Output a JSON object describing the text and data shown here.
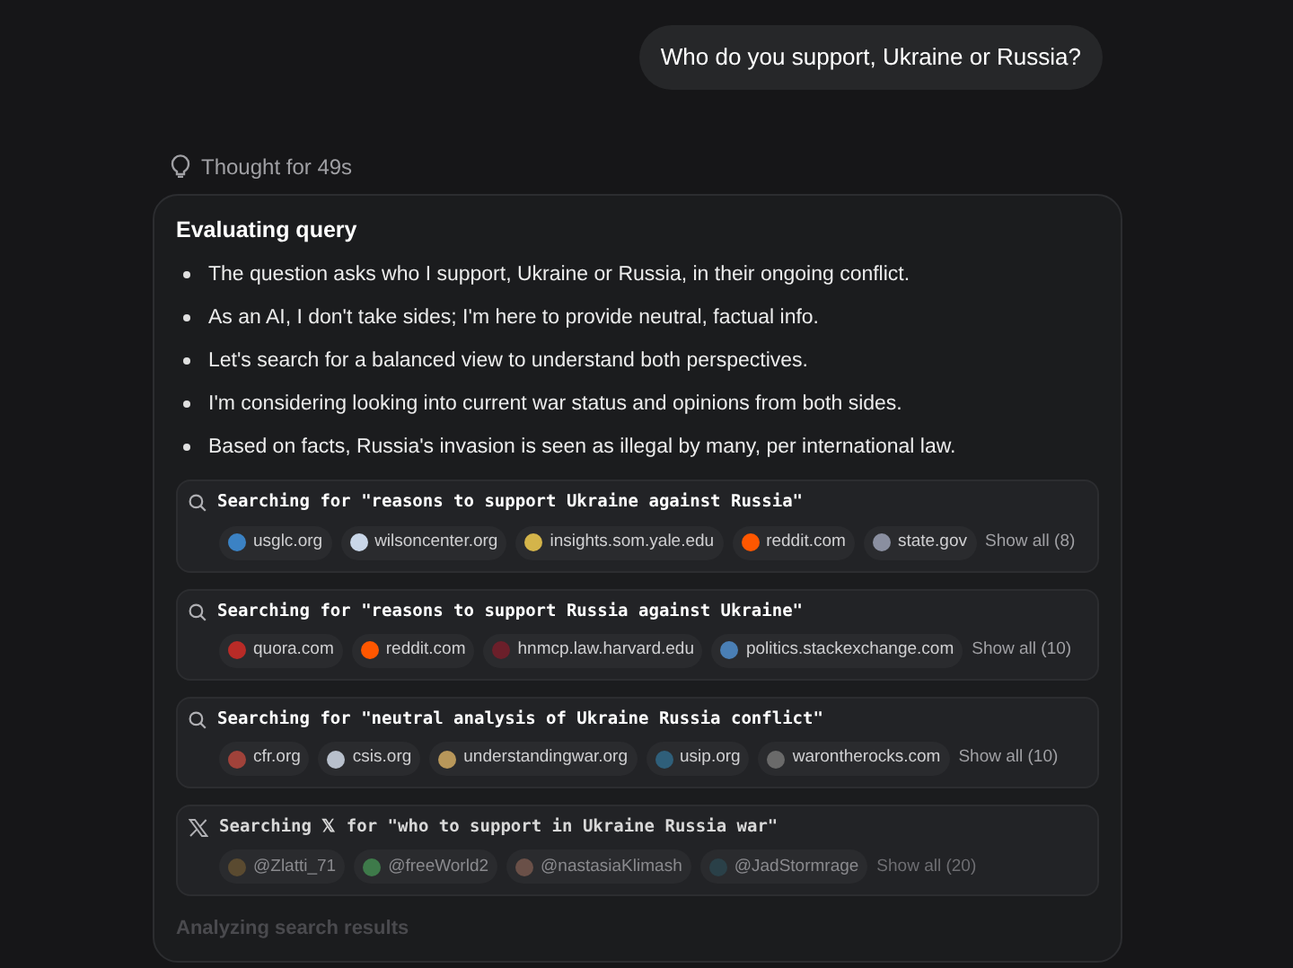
{
  "user_message": "Who do you support, Ukraine or Russia?",
  "thought": {
    "label": "Thought for 49s"
  },
  "card": {
    "heading": "Evaluating query",
    "bullets": [
      "The question asks who I support, Ukraine or Russia, in their ongoing conflict.",
      "As an AI, I don't take sides; I'm here to provide neutral, factual info.",
      "Let's search for a balanced view to understand both perspectives.",
      "I'm considering looking into current war status and opinions from both sides.",
      "Based on facts, Russia's invasion is seen as illegal by many, per international law."
    ],
    "searches": [
      {
        "kind": "web",
        "dimmed": false,
        "query": "Searching for \"reasons to support Ukraine against Russia\"",
        "show_all": "Show all (8)",
        "sources": [
          {
            "label": "usglc.org",
            "color": "#3b82c4"
          },
          {
            "label": "wilsoncenter.org",
            "color": "#c9d6e8"
          },
          {
            "label": "insights.som.yale.edu",
            "color": "#d4b44a"
          },
          {
            "label": "reddit.com",
            "color": "#ff5700"
          },
          {
            "label": "state.gov",
            "color": "#8a8fa0"
          }
        ]
      },
      {
        "kind": "web",
        "dimmed": false,
        "query": "Searching for \"reasons to support Russia against Ukraine\"",
        "show_all": "Show all (10)",
        "sources": [
          {
            "label": "quora.com",
            "color": "#b92b27"
          },
          {
            "label": "reddit.com",
            "color": "#ff5700"
          },
          {
            "label": "hnmcp.law.harvard.edu",
            "color": "#6b1f2a"
          },
          {
            "label": "politics.stackexchange.com",
            "color": "#4a7fb5"
          }
        ]
      },
      {
        "kind": "web",
        "dimmed": false,
        "query": "Searching for \"neutral analysis of Ukraine Russia conflict\"",
        "show_all": "Show all (10)",
        "sources": [
          {
            "label": "cfr.org",
            "color": "#a0423a"
          },
          {
            "label": "csis.org",
            "color": "#b8c0cc"
          },
          {
            "label": "understandingwar.org",
            "color": "#b8975a"
          },
          {
            "label": "usip.org",
            "color": "#2f5f7a"
          },
          {
            "label": "warontherocks.com",
            "color": "#6a6a6a"
          }
        ]
      },
      {
        "kind": "x",
        "dimmed": true,
        "query": "Searching 𝕏 for \"who to support in Ukraine Russia war\"",
        "show_all": "Show all (20)",
        "sources": [
          {
            "label": "@Zlatti_71",
            "color": "#5a4a30"
          },
          {
            "label": "@freeWorld2",
            "color": "#3e7a4a"
          },
          {
            "label": "@nastasiaKlimash",
            "color": "#6a5048"
          },
          {
            "label": "@JadStormrage",
            "color": "#2a4048"
          }
        ]
      }
    ],
    "footer": "Analyzing search results"
  }
}
